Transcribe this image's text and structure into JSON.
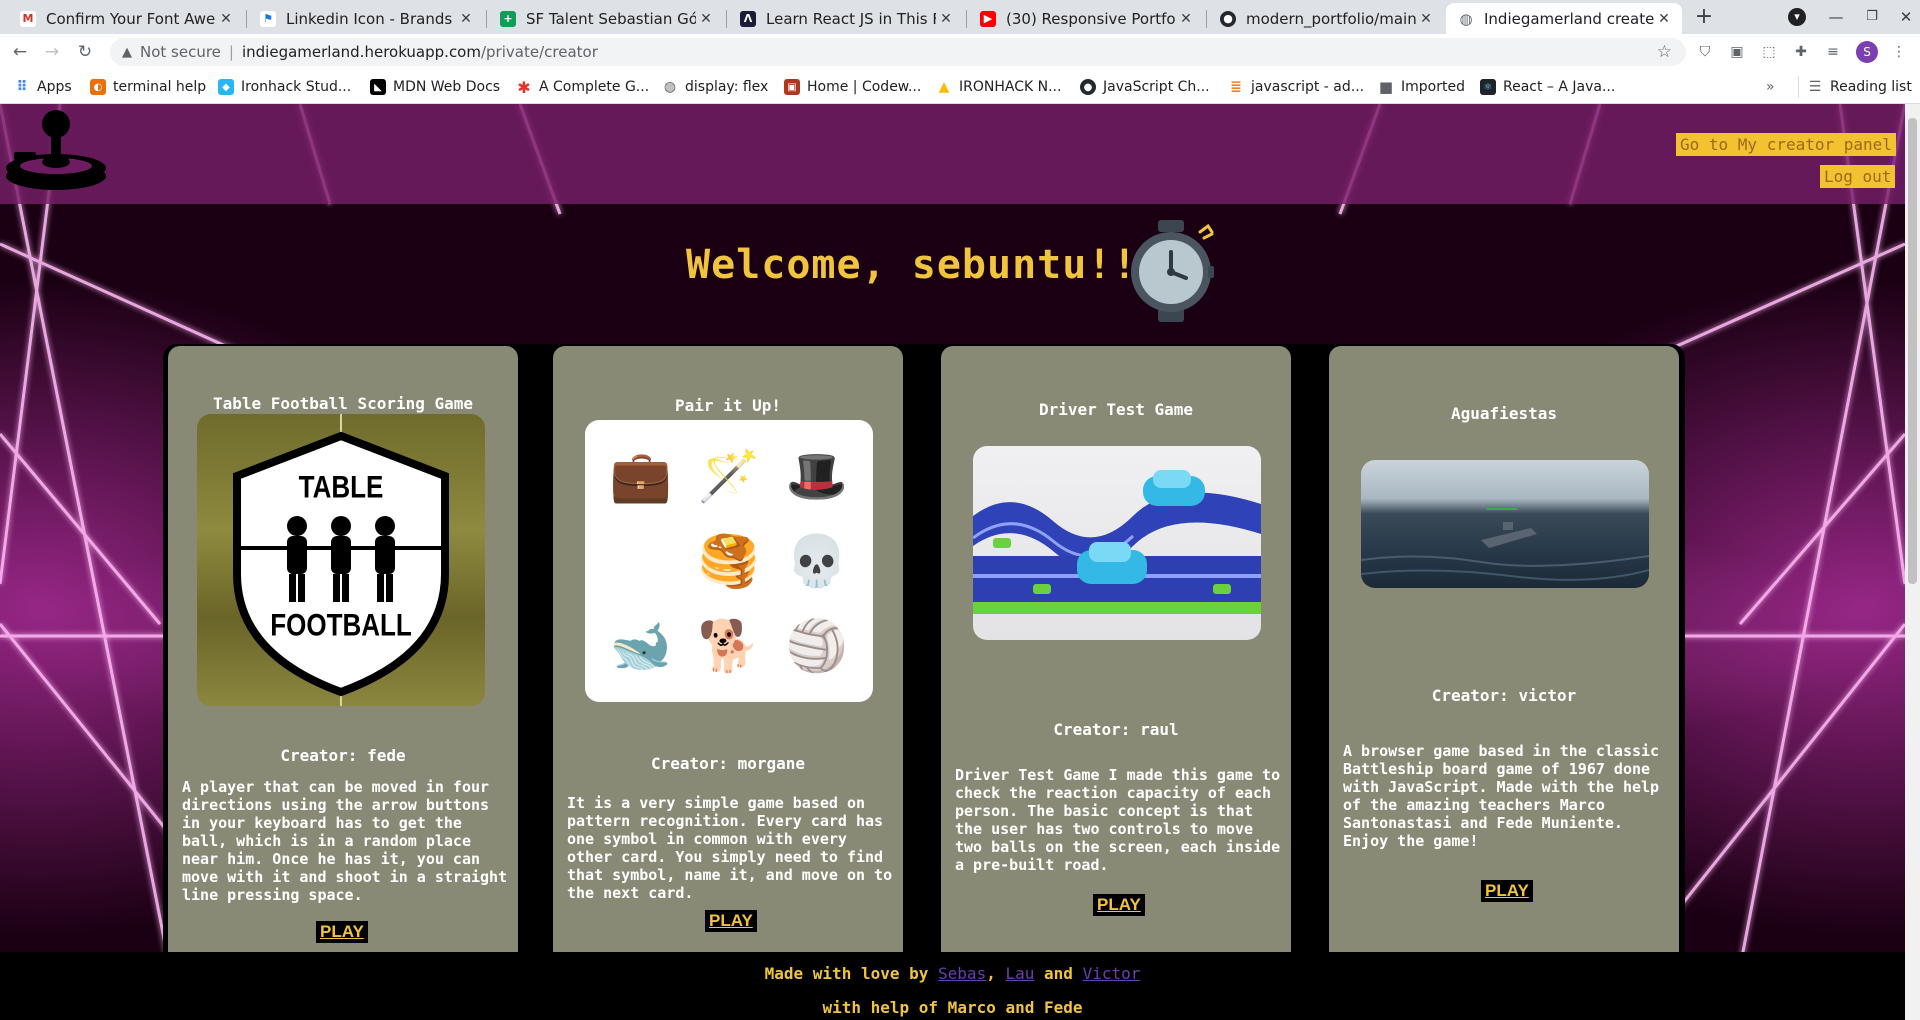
{
  "browser": {
    "tabs": [
      {
        "title": "Confirm Your Font Awesome",
        "favicon": "gmail-icon",
        "color": "#d93025",
        "glyph": "M"
      },
      {
        "title": "Linkedin Icon - Brands | Font",
        "favicon": "flag-icon",
        "color": "#1a73e8",
        "glyph": "⚑"
      },
      {
        "title": "SF Talent Sebastian Gómez",
        "favicon": "sheets-icon",
        "color": "#0f9d58",
        "glyph": "+"
      },
      {
        "title": "Learn React JS in This Free",
        "favicon": "scrimba-icon",
        "color": "#1b1b3a",
        "glyph": "Λ"
      },
      {
        "title": "(30) Responsive Portfolio",
        "favicon": "youtube-icon",
        "color": "#ff0000",
        "glyph": "▶"
      },
      {
        "title": "modern_portfolio/main.s",
        "favicon": "github-icon",
        "color": "#24292e",
        "glyph": "●"
      },
      {
        "title": "Indiegamerland created w",
        "favicon": "globe-icon",
        "color": "#5f6368",
        "glyph": "◍"
      }
    ],
    "address": {
      "not_secure": "Not secure",
      "host": "indiegamerland.herokuapp.com",
      "path": "/private/creator"
    },
    "profile_initial": "S",
    "bookmarks": [
      {
        "label": "Apps",
        "icon": "apps-grid-icon",
        "color": "#4285f4"
      },
      {
        "label": "terminal help",
        "icon": "bookmark-icon",
        "color": "#e8710a"
      },
      {
        "label": "Ironhack Stud...",
        "icon": "ironhack-icon",
        "color": "#29b6f6"
      },
      {
        "label": "MDN Web Docs",
        "icon": "mdn-icon",
        "color": "#000000"
      },
      {
        "label": "A Complete G...",
        "icon": "asterisk-icon",
        "color": "#e5332a"
      },
      {
        "label": "display: flex",
        "icon": "globe-icon",
        "color": "#5f6368"
      },
      {
        "label": "Home | Codew...",
        "icon": "codewars-icon",
        "color": "#b1361e"
      },
      {
        "label": "IRONHACK N...",
        "icon": "drive-icon",
        "color": "#fbbc04"
      },
      {
        "label": "JavaScript Ch...",
        "icon": "github-icon",
        "color": "#24292e"
      },
      {
        "label": "javascript - ad...",
        "icon": "stackoverflow-icon",
        "color": "#f48024"
      },
      {
        "label": "Imported",
        "icon": "folder-icon",
        "color": "#5f6368"
      },
      {
        "label": "React – A Java...",
        "icon": "react-icon",
        "color": "#20232a"
      }
    ],
    "reading_list": "Reading list"
  },
  "header": {
    "creator_panel_button": "Go to My creator panel",
    "logout_button": "Log out"
  },
  "welcome": "Welcome, sebuntu!!",
  "cards": [
    {
      "title": "Table Football Scoring Game",
      "image_text_top": "TABLE",
      "image_text_bottom": "FOOTBALL",
      "creator": "Creator: fede",
      "description": "A player that can be moved in four directions using the arrow buttons in your keyboard has to get the ball, which is in a random place near him. Once he has it, you can move with it and shoot in a straight line pressing space.",
      "play": "PLAY"
    },
    {
      "title": "Pair it Up!",
      "image_symbols": [
        "💼",
        "🪄",
        "🎩",
        "🏵",
        "🥞",
        "💀",
        "🐋",
        "🐕",
        "🏐"
      ],
      "creator": "Creator: morgane",
      "description": "It is a very simple game based on pattern recognition. Every card has one symbol in common with every other card. You simply need to find that symbol, name it, and move on to the next card.",
      "play": "PLAY"
    },
    {
      "title": "Driver Test Game",
      "creator": "Creator: raul",
      "description": "Driver Test Game I made this game to check the reaction capacity of each person. The basic concept is that the user has two controls to move two balls on the screen, each inside a pre-built road.",
      "play": "PLAY"
    },
    {
      "title": "Aguafiestas",
      "creator": "Creator: victor",
      "description": "A browser game based in the classic Battleship board game of 1967 done with JavaScript. Made with the help of the amazing teachers Marco Santonastasi and Fede Muniente. Enjoy the game!",
      "play": "PLAY"
    }
  ],
  "footer": {
    "made_with": "Made with love by",
    "author1": "Sebas",
    "comma": ",",
    "author2": "Lau",
    "and": "and",
    "author3": "Victor",
    "help": "with help of Marco and Fede"
  }
}
